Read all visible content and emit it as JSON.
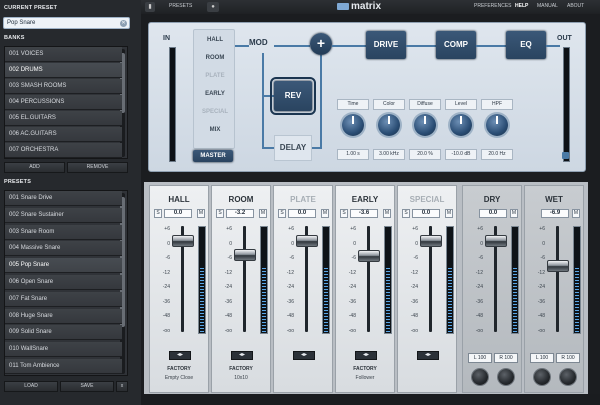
{
  "left": {
    "current_preset_label": "CURRENT PRESET",
    "current_preset_value": "Pop Snare",
    "banks_label": "BANKS",
    "banks": [
      {
        "num": "001",
        "name": "VOICES",
        "selected": false
      },
      {
        "num": "002",
        "name": "DRUMS",
        "selected": true
      },
      {
        "num": "003",
        "name": "SMASH ROOMS",
        "selected": false
      },
      {
        "num": "004",
        "name": "PERCUSSIONS",
        "selected": false
      },
      {
        "num": "005",
        "name": "EL.GUITARS",
        "selected": false
      },
      {
        "num": "006",
        "name": "AC.GUITARS",
        "selected": false
      },
      {
        "num": "007",
        "name": "ORCHESTRA",
        "selected": false
      }
    ],
    "add_label": "ADD",
    "remove_label": "REMOVE",
    "presets_label": "PRESETS",
    "presets": [
      {
        "num": "001",
        "name": "Snare Drive",
        "selected": false
      },
      {
        "num": "002",
        "name": "Snare Sustainer",
        "selected": false
      },
      {
        "num": "003",
        "name": "Snare Room",
        "selected": false
      },
      {
        "num": "004",
        "name": "Massive Snare",
        "selected": false
      },
      {
        "num": "005",
        "name": "Pop Snare",
        "selected": true
      },
      {
        "num": "006",
        "name": "Open Snare",
        "selected": false
      },
      {
        "num": "007",
        "name": "Fat Snare",
        "selected": false
      },
      {
        "num": "008",
        "name": "Huge Snare",
        "selected": false
      },
      {
        "num": "009",
        "name": "Solid Snare",
        "selected": false
      },
      {
        "num": "010",
        "name": "WallSnare",
        "selected": false
      },
      {
        "num": "011",
        "name": "Tom Ambience",
        "selected": false
      }
    ],
    "load_label": "LOAD",
    "save_label": "SAVE",
    "close_label": "x"
  },
  "topbar": {
    "presets_label": "PRESETS",
    "logo_text": "matrix",
    "menu": [
      "PREFERENCES",
      "HELP",
      "MANUAL",
      "ABOUT"
    ]
  },
  "routing": {
    "in_label": "IN",
    "out_label": "OUT",
    "slots": [
      {
        "label": "HALL",
        "dim": false
      },
      {
        "label": "ROOM",
        "dim": false
      },
      {
        "label": "PLATE",
        "dim": true
      },
      {
        "label": "EARLY",
        "dim": false
      },
      {
        "label": "SPECIAL",
        "dim": true
      },
      {
        "label": "MIX",
        "dim": false
      }
    ],
    "master_label": "MASTER",
    "mod_label": "MOD",
    "plus_label": "+",
    "drive_label": "DRIVE",
    "comp_label": "COMP",
    "eq_label": "EQ",
    "rev_label": "REV",
    "delay_label": "DELAY",
    "knobs": [
      {
        "label": "Time",
        "value": "1.00 s"
      },
      {
        "label": "Color",
        "value": "3.00 kHz"
      },
      {
        "label": "Diffuse",
        "value": "20.0 %"
      },
      {
        "label": "Level",
        "value": "-10.0 dB"
      },
      {
        "label": "HPF",
        "value": "20.0 Hz"
      }
    ]
  },
  "mixer": {
    "scale": [
      "+6",
      "0",
      "-6",
      "-12",
      "-24",
      "-36",
      "-48",
      "-oo"
    ],
    "strips": [
      {
        "title": "HALL",
        "value": "0.0",
        "disabled": false,
        "factory": "FACTORY",
        "sub": "Empty Close",
        "fader": 0.14
      },
      {
        "title": "ROOM",
        "value": "-3.2",
        "disabled": false,
        "factory": "FACTORY",
        "sub": "10x10",
        "fader": 0.27
      },
      {
        "title": "PLATE",
        "value": "0.0",
        "disabled": true,
        "factory": "",
        "sub": "",
        "fader": 0.14
      },
      {
        "title": "EARLY",
        "value": "-3.6",
        "disabled": false,
        "factory": "FACTORY",
        "sub": "Follower",
        "fader": 0.28
      },
      {
        "title": "SPECIAL",
        "value": "0.0",
        "disabled": true,
        "factory": "",
        "sub": "",
        "fader": 0.14
      }
    ],
    "dry": {
      "title": "DRY",
      "value": "0.0",
      "l": "L 100",
      "r": "R 100",
      "fader": 0.14
    },
    "wet": {
      "title": "WET",
      "value": "-6.9",
      "l": "L 100",
      "r": "R 100",
      "fader": 0.38
    },
    "s_label": "S",
    "m_label": "M"
  }
}
